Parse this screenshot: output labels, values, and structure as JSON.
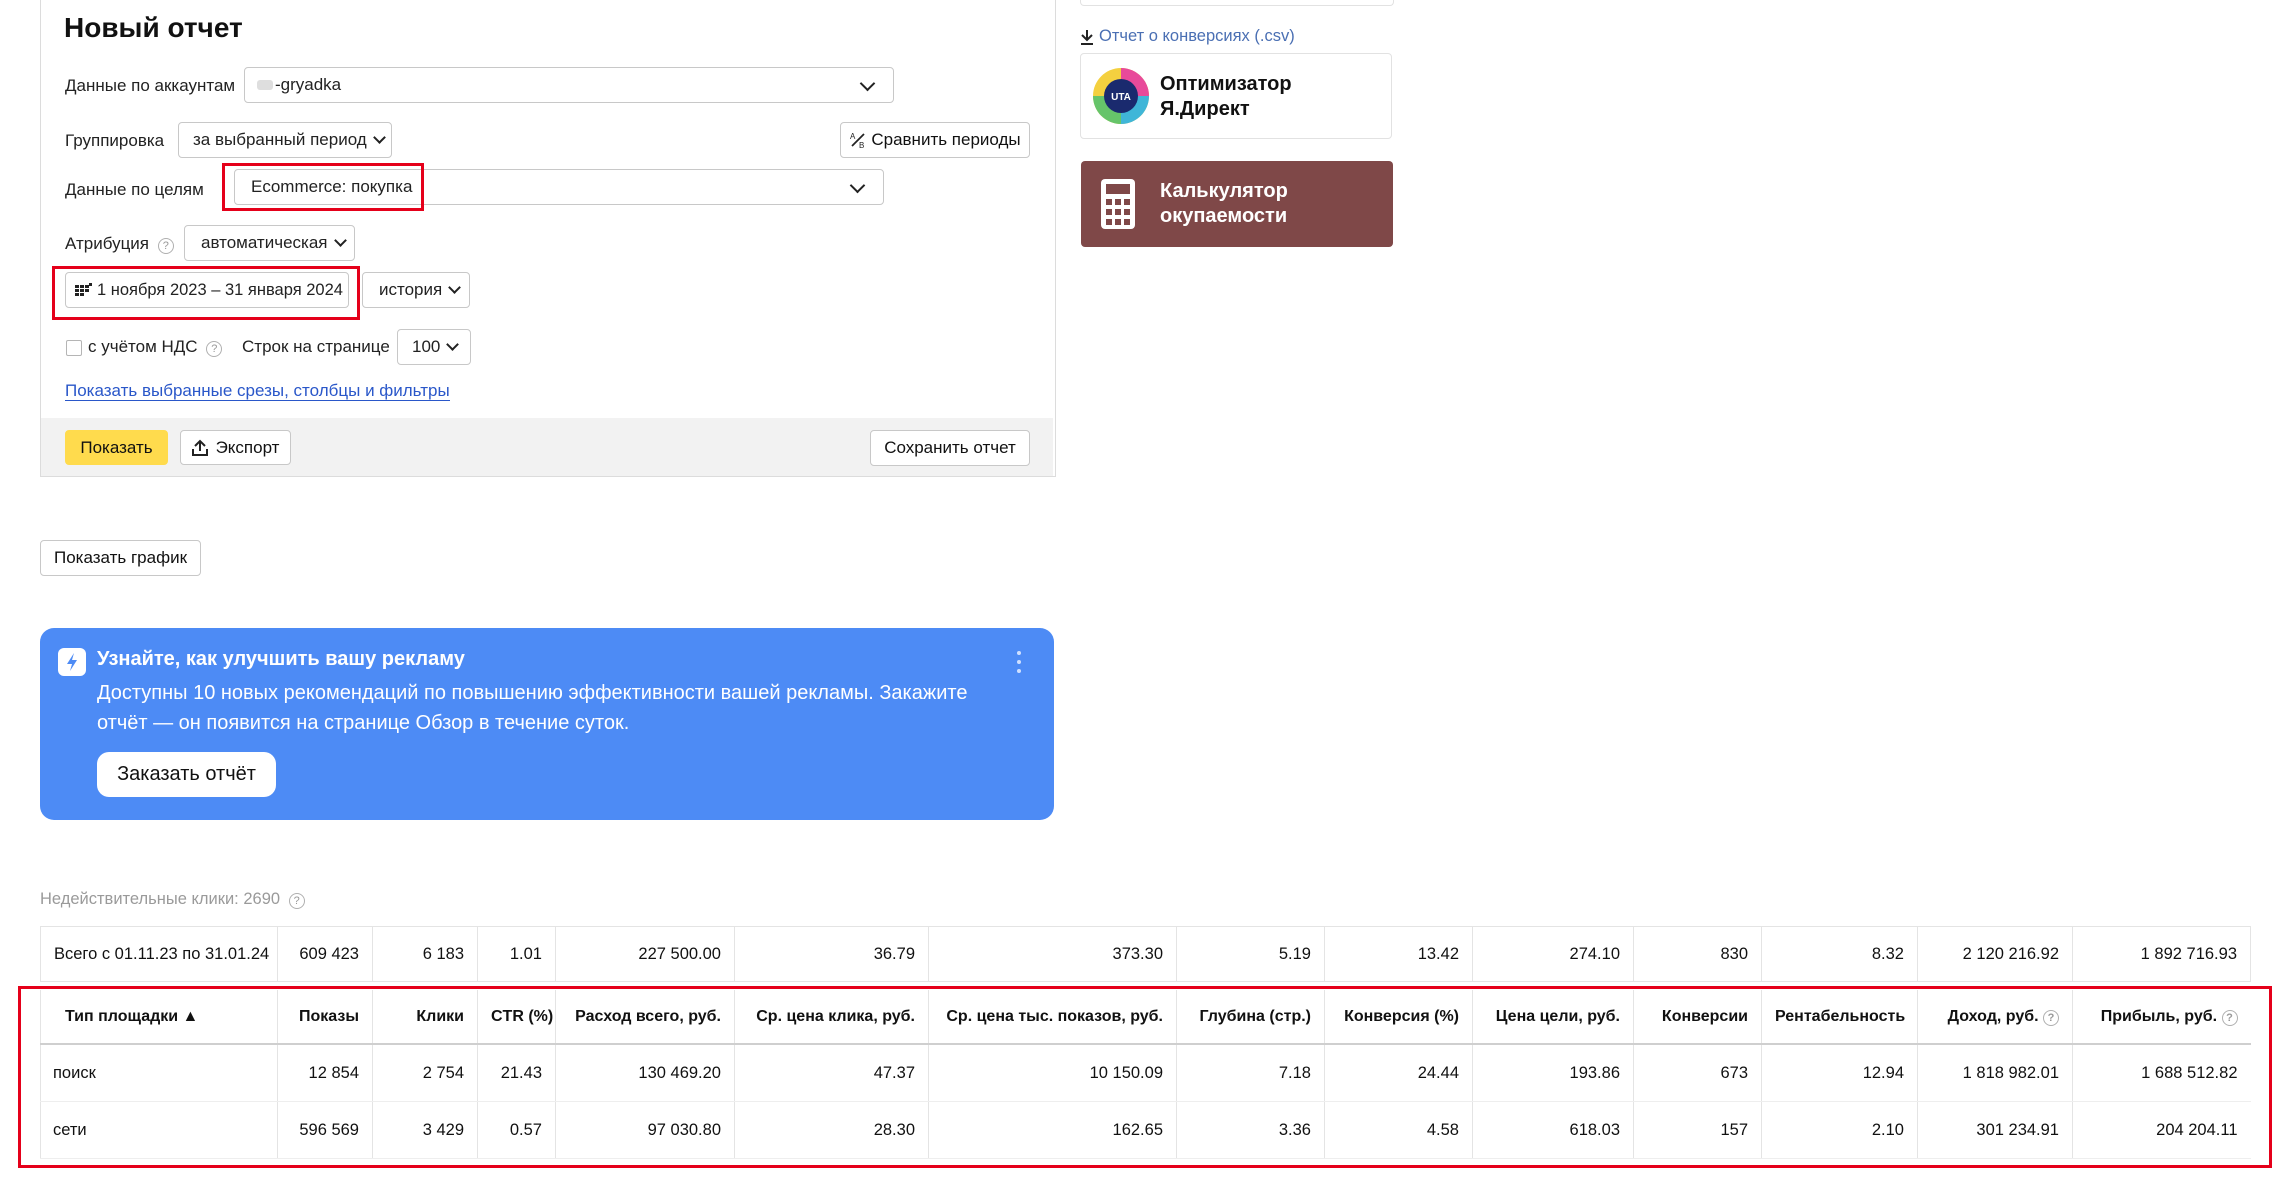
{
  "form": {
    "title": "Новый отчет",
    "accounts_label": "Данные по аккаунтам",
    "accounts_value": "-gryadka",
    "grouping_label": "Группировка",
    "grouping_value": "за выбранный период",
    "compare_button": "Сравнить периоды",
    "goals_label": "Данные по целям",
    "goals_value": "Ecommerce: покупка",
    "attribution_label": "Атрибуция",
    "attribution_value": "автоматическая",
    "date_range": "1 ноября 2023 – 31 января 2024",
    "history_value": "история",
    "vat_label": "с учётом НДС",
    "rows_label": "Строк на странице",
    "rows_value": "100",
    "show_filters_link": "Показать выбранные срезы, столбцы и фильтры",
    "show_button": "Показать",
    "export_button": "Экспорт",
    "save_button": "Сохранить отчет"
  },
  "sidebar": {
    "csv_link": "Отчет о конверсиях (.csv)",
    "optimizer_logo_text": "UTA",
    "optimizer_title_1": "Оптимизатор",
    "optimizer_title_2": "Я.Директ",
    "calc_title_1": "Калькулятор",
    "calc_title_2": "окупаемости"
  },
  "show_chart_button": "Показать график",
  "banner": {
    "title": "Узнайте, как улучшить вашу рекламу",
    "text_1": "Доступны 10 новых рекомендаций по повышению эффективности вашей рекламы. Закажите",
    "text_2": "отчёт — он появится на странице Обзор в течение суток.",
    "button": "Заказать отчёт"
  },
  "invalid_clicks": "Недействительные клики: 2690",
  "table": {
    "totals": [
      "Всего с 01.11.23 по 31.01.24",
      "609 423",
      "6 183",
      "1.01",
      "227 500.00",
      "36.79",
      "373.30",
      "5.19",
      "13.42",
      "274.10",
      "830",
      "8.32",
      "2 120 216.92",
      "1 892 716.93"
    ],
    "headers": [
      "Тип площадки ▲",
      "Показы",
      "Клики",
      "CTR (%)",
      "Расход всего, руб.",
      "Ср. цена клика, руб.",
      "Ср. цена тыс. показов, руб.",
      "Глубина (стр.)",
      "Конверсия (%)",
      "Цена цели, руб.",
      "Конверсии",
      "Рентабельность",
      "Доход, руб.",
      "Прибыль, руб."
    ],
    "rows": [
      [
        "поиск",
        "12 854",
        "2 754",
        "21.43",
        "130 469.20",
        "47.37",
        "10 150.09",
        "7.18",
        "24.44",
        "193.86",
        "673",
        "12.94",
        "1 818 982.01",
        "1 688 512.82"
      ],
      [
        "сети",
        "596 569",
        "3 429",
        "0.57",
        "97 030.80",
        "28.30",
        "162.65",
        "3.36",
        "4.58",
        "618.03",
        "157",
        "2.10",
        "301 234.91",
        "204 204.11"
      ]
    ]
  },
  "colors": {
    "accent_yellow": "#ffdb4d",
    "banner_blue": "#4d8bf5",
    "calc_bg": "#7f4848",
    "highlight_red": "#e5001a",
    "link_blue": "#2a57c9"
  }
}
